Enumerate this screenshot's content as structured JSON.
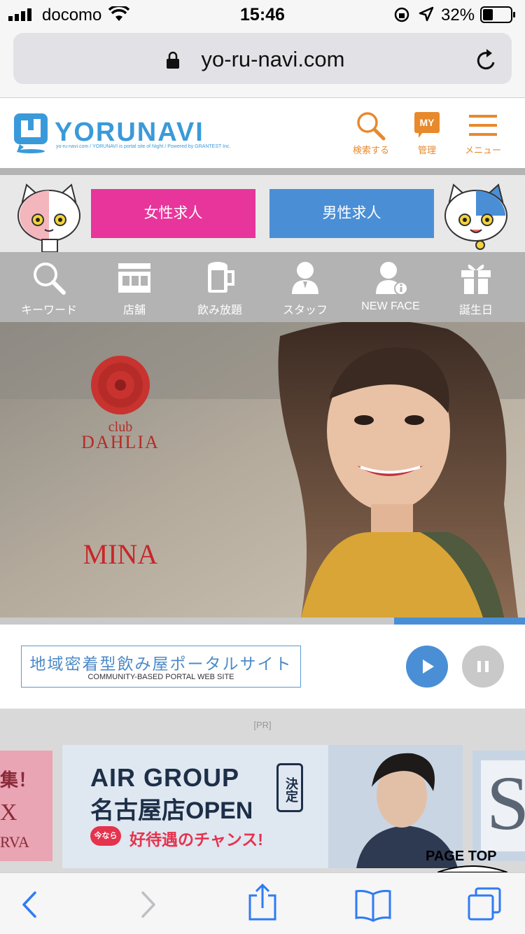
{
  "status_bar": {
    "carrier": "docomo",
    "time": "15:46",
    "battery": "32%"
  },
  "browser": {
    "url": "yo-ru-navi.com"
  },
  "header": {
    "logo_text": "YORUNAVI",
    "logo_tagline": "yo-ru-navi.com / YORUNAVI is portal site of Night / Powered by GRANTEST Inc.",
    "search_label": "検索する",
    "my_badge": "MY",
    "my_label": "管理",
    "menu_label": "メニュー"
  },
  "jobs": {
    "female": "女性求人",
    "male": "男性求人"
  },
  "categories": [
    {
      "label": "キーワード"
    },
    {
      "label": "店舗"
    },
    {
      "label": "飲み放題"
    },
    {
      "label": "スタッフ"
    },
    {
      "label": "NEW FACE"
    },
    {
      "label": "誕生日"
    }
  ],
  "hero": {
    "club_small": "club",
    "club_name": "DAHLIA",
    "person_name": "MINA"
  },
  "slider": {
    "progress": 0.25
  },
  "portal": {
    "title_jp": "地域密着型飲み屋ポータルサイト",
    "title_en": "COMMUNITY-BASED PORTAL WEB SITE"
  },
  "pr": {
    "label": "[PR]",
    "left_partial_1": "集！",
    "left_partial_2": "X",
    "left_partial_3": "RVA",
    "ad_line1": "AIR GROUP",
    "ad_line2": "名古屋店OPEN",
    "ad_badge": "決定",
    "ad_pill": "今なら",
    "ad_line3": "好待遇のチャンス!",
    "right_partial": "S",
    "page_top": "PAGE TOP"
  },
  "colors": {
    "accent_orange": "#e8892c",
    "female_pink": "#e8359b",
    "male_blue": "#4a8fd6",
    "logo_blue": "#3a9ad9"
  }
}
